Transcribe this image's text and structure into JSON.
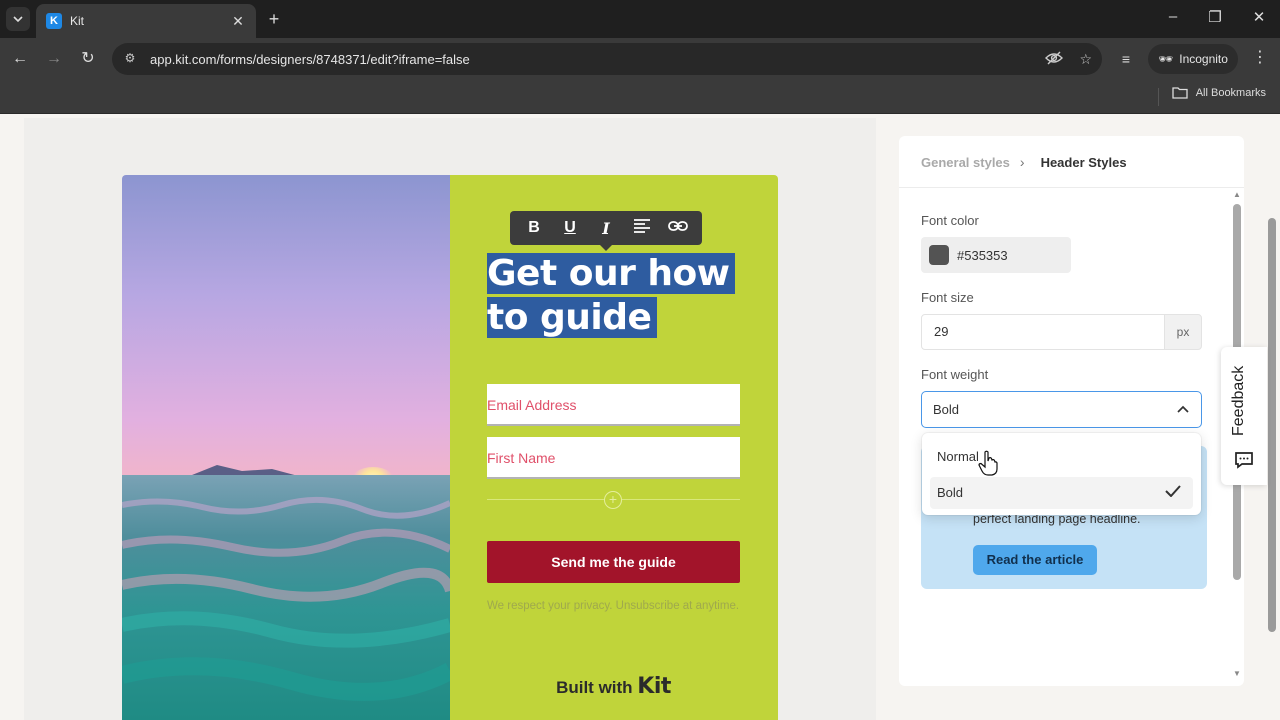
{
  "browser": {
    "tab_title": "Kit",
    "tab_favicon_letter": "K",
    "url": "app.kit.com/forms/designers/8748371/edit?iframe=false",
    "profile_label": "Incognito",
    "bookmarks_label": "All Bookmarks"
  },
  "form": {
    "headline": "Get our how to guide",
    "fields": [
      {
        "placeholder": "Email Address"
      },
      {
        "placeholder": "First Name"
      }
    ],
    "submit_label": "Send me the guide",
    "privacy_text": "We respect your privacy. Unsubscribe at anytime.",
    "built_with": "Built with",
    "brand": "Kit",
    "toolbar": [
      "B",
      "U",
      "I"
    ]
  },
  "panel": {
    "breadcrumb_parent": "General styles",
    "breadcrumb_current": "Header Styles",
    "font_color_label": "Font color",
    "font_color_value": "#535353",
    "font_size_label": "Font size",
    "font_size_value": "29",
    "font_size_unit": "px",
    "font_weight_label": "Font weight",
    "font_weight_value": "Bold",
    "font_weight_options": [
      "Normal",
      "Bold"
    ],
    "info_text": "perfect landing page headline.",
    "info_button": "Read the article"
  },
  "feedback_label": "Feedback",
  "colors": {
    "form_accent": "#c0d43a",
    "submit": "#a2142a",
    "selection": "#2e5ca0",
    "focus": "#4a97e8"
  }
}
